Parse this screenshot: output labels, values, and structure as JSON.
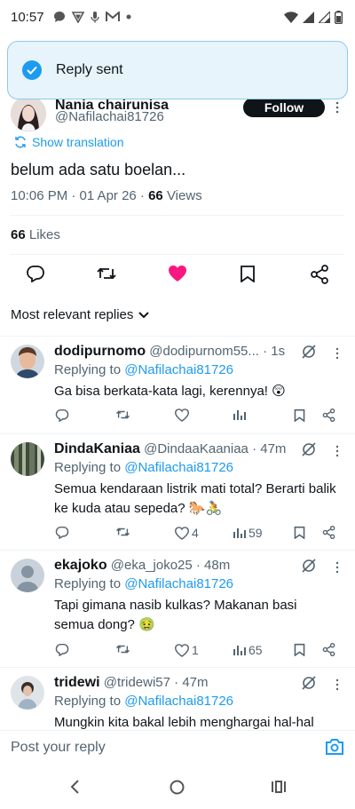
{
  "status_bar": {
    "time": "10:57",
    "icons_left": [
      "chat-bubble-icon",
      "vpn-shield-icon",
      "mic-icon",
      "gmail-icon",
      "dot-icon"
    ],
    "icons_right": [
      "wifi-icon",
      "signal-icon",
      "signal-icon",
      "battery-icon"
    ]
  },
  "toast": {
    "text": "Reply sent",
    "icon": "check-circle-icon"
  },
  "tweet": {
    "author_name": "Nania chairunisa",
    "author_handle": "@Nafilachai81726",
    "follow_label": "Follow",
    "translate_label": "Show translation",
    "text": "belum ada satu boelan...",
    "timestamp": "10:06 PM · 01 Apr 26 · ",
    "views_count": "66",
    "views_label": " Views",
    "likes_count": "66",
    "likes_label": " Likes",
    "liked": true
  },
  "sort_label": "Most relevant replies",
  "replies": [
    {
      "name": "dodipurnomo",
      "handle_time": "@dodipurnom55... · 1s",
      "replying_prefix": "Replying to ",
      "replying_to": "@Nafilachai81726",
      "text": "Ga bisa berkata-kata lagi, kerennya! 😲",
      "likes": "",
      "views": ""
    },
    {
      "name": "DindaKaniaa",
      "handle_time": "@DindaaKaaniaa · 47m",
      "replying_prefix": "Replying to ",
      "replying_to": "@Nafilachai81726",
      "text": "Semua kendaraan listrik mati total? Berarti balik ke kuda atau sepeda? 🐎🚴",
      "likes": "4",
      "views": "59"
    },
    {
      "name": "ekajoko",
      "handle_time": "@eka_joko25 · 48m",
      "replying_prefix": "Replying to ",
      "replying_to": "@Nafilachai81726",
      "text": "Tapi gimana nasib kulkas? Makanan basi semua dong? 🤢",
      "likes": "1",
      "views": "65"
    },
    {
      "name": "tridewi",
      "handle_time": "@tridewi57 · 47m",
      "replying_prefix": "Replying to ",
      "replying_to": "@Nafilachai81726",
      "text": "Mungkin kita bakal lebih menghargai hal-hal",
      "likes": "",
      "views": ""
    }
  ],
  "composer": {
    "placeholder": "Post your reply"
  },
  "colors": {
    "accent": "#1d9bf0",
    "like": "#f91880",
    "text": "#0f1419",
    "muted": "#536471"
  }
}
